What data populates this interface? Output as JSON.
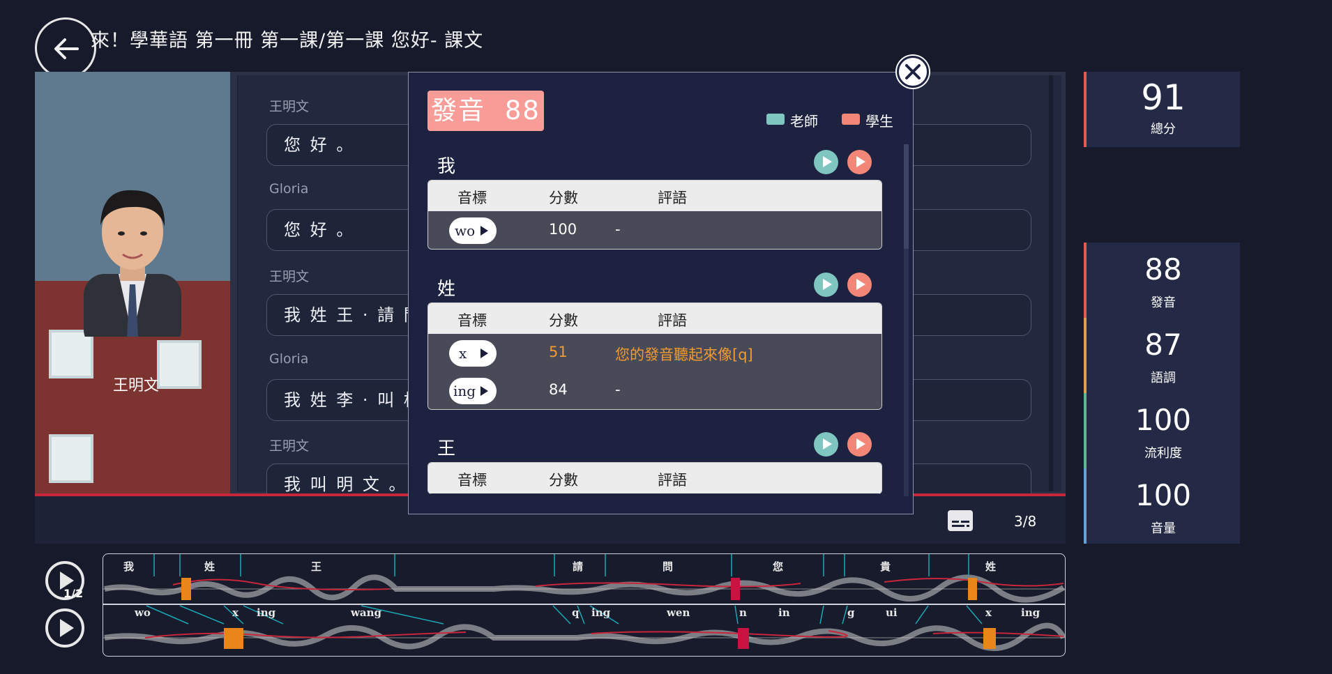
{
  "header": {
    "title": "來！學華語 第一冊 第一課/第一課 您好- 課文"
  },
  "speaker": {
    "name": "王明文"
  },
  "dialogue": [
    {
      "speaker": "王明文",
      "text": "您 好 。"
    },
    {
      "speaker": "Gloria",
      "text": "您 好 。"
    },
    {
      "speaker": "王明文",
      "text": "我 姓 王 · 請 問"
    },
    {
      "speaker": "Gloria",
      "text": "我 姓 李 · 叫 格"
    },
    {
      "speaker": "王明文",
      "text": "我 叫 明 文 。 請"
    }
  ],
  "controls": {
    "page_count": "3/8",
    "speed_label": "1/2"
  },
  "scores": [
    {
      "value": "91",
      "label": "總分",
      "color": "#e05a4f"
    },
    {
      "value": "88",
      "label": "發音",
      "color": "#e05a4f"
    },
    {
      "value": "87",
      "label": "語調",
      "color": "#e0a04f"
    },
    {
      "value": "100",
      "label": "流利度",
      "color": "#5fb892"
    },
    {
      "value": "100",
      "label": "音量",
      "color": "#6a9fd8"
    }
  ],
  "popup": {
    "badge_label": "發音",
    "badge_score": "88",
    "legend": {
      "teacher": "老師",
      "student": "學生",
      "teacher_color": "#7fc6c0",
      "student_color": "#f38777"
    },
    "columns": {
      "phonetic": "音標",
      "score": "分數",
      "comment": "評語"
    },
    "words": [
      {
        "char": "我",
        "rows": [
          {
            "phonetic": "wo",
            "score": "100",
            "comment": "-"
          }
        ]
      },
      {
        "char": "姓",
        "rows": [
          {
            "phonetic": "x",
            "score": "51",
            "comment": "您的發音聽起來像[q]",
            "warn": true
          },
          {
            "phonetic": "ing",
            "score": "84",
            "comment": "-"
          }
        ]
      },
      {
        "char": "王",
        "rows": []
      }
    ]
  },
  "waveform": {
    "top_labels": [
      "我",
      "姓",
      "王",
      "請",
      "問",
      "您",
      "貴",
      "姓"
    ],
    "bottom_labels": [
      "wo",
      "x",
      "ing",
      "wang",
      "q",
      "ing",
      "wen",
      "n",
      "in",
      "g",
      "ui",
      "x",
      "ing"
    ]
  }
}
